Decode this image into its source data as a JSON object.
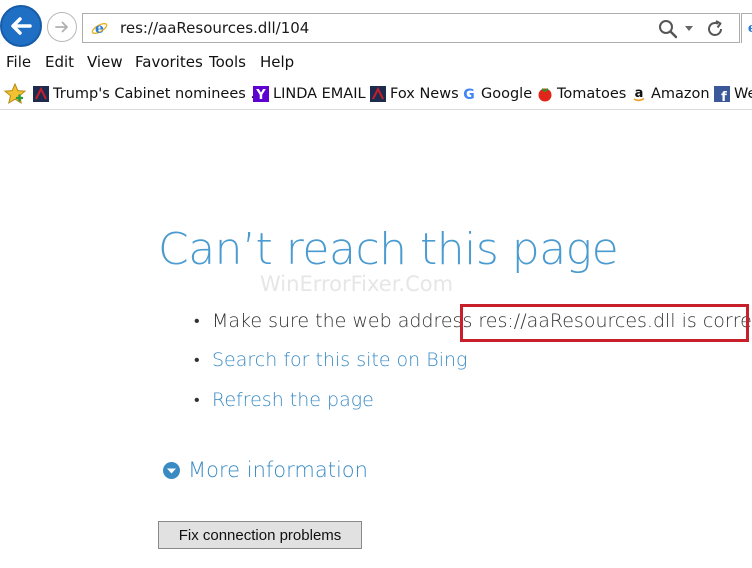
{
  "address_bar": {
    "url": "res://aaResources.dll/104"
  },
  "menu": {
    "items": [
      "File",
      "Edit",
      "View",
      "Favorites",
      "Tools",
      "Help"
    ]
  },
  "favorites": {
    "items": [
      {
        "label": "Trump's Cabinet nominees ...",
        "icon": "news-icon"
      },
      {
        "label": "LINDA EMAIL",
        "icon": "yahoo-icon"
      },
      {
        "label": "Fox News",
        "icon": "news-icon"
      },
      {
        "label": "Google",
        "icon": "google-icon"
      },
      {
        "label": "Tomatoes",
        "icon": "tomato-icon"
      },
      {
        "label": "Amazon",
        "icon": "amazon-icon"
      },
      {
        "label": "We",
        "icon": "facebook-icon"
      }
    ]
  },
  "error_page": {
    "title": "Can’t reach this page",
    "watermark": "WinErrorFixer.Com",
    "line1_prefix": "Make sure the web address",
    "line1_highlight": "res://aaResources.dll is correct",
    "search_link": "Search for this site on Bing",
    "refresh_link": "Refresh the page",
    "more_info": "More information",
    "fix_button": "Fix connection problems"
  },
  "colors": {
    "title": "#4a9bd0",
    "link": "#3a8bc4",
    "highlight_border": "#c8202a",
    "back_button": "#1f6fc4"
  }
}
